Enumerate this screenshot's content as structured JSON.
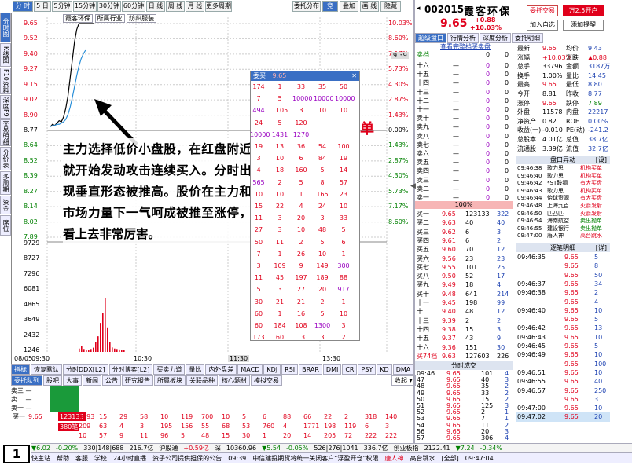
{
  "toolbar": {
    "tabs": [
      "分 时",
      "5 日",
      "5分钟",
      "15分钟",
      "30分钟",
      "60分钟",
      "日 线",
      "周 线",
      "月 线",
      "更多周期"
    ],
    "right_buttons": [
      "委托分布",
      "竞 价",
      "叠加",
      "画 线",
      "隐藏"
    ],
    "sector_tabs": [
      "霞客环保",
      "所属行业",
      "纺织服装"
    ]
  },
  "side_tabs": [
    "分时图",
    "K线图",
    "F10资料",
    "深度F9",
    "交易明细",
    "分价表",
    "多周期",
    "资金",
    "席位"
  ],
  "price_axis": {
    "left": [
      "9.65",
      "9.52",
      "9.40",
      "9.27",
      "9.15",
      "9.02",
      "8.90",
      "8.77",
      "8.64",
      "8.52",
      "8.39",
      "8.27",
      "8.14",
      "8.02",
      "7.89"
    ],
    "right": [
      "10.03%",
      "8.60%",
      "7.17%",
      "5.73%",
      "4.30%",
      "2.87%",
      "1.43%",
      "0.00%",
      "1.43%",
      "2.87%",
      "4.30%",
      "5.73%",
      "7.17%",
      "8.60%"
    ],
    "current_tag": "9.39"
  },
  "volume_axis": [
    "9729",
    "8727",
    "7296",
    "6081",
    "4865",
    "3649",
    "2432",
    "1216",
    "1246"
  ],
  "volume_axis_left": [
    "9729",
    "8727",
    "7296",
    "6081",
    "4865",
    "3649",
    "2432",
    "1246"
  ],
  "time_axis": [
    "09:30",
    "10:30",
    "11:30",
    "13:30"
  ],
  "date_label": "08/05",
  "annotation": {
    "text": "主力选择低价小盘股，在红盘附近就开始发动攻击连续买入。分时出现垂直形态被推高。股价在主力和市场力量下一气呵成被推至涨停，看上去非常厉害。",
    "badge": "机构封单",
    "page_number": "1"
  },
  "order_queue": {
    "header": "委买",
    "header_value": "9.65",
    "rows": [
      [
        "174",
        "1",
        "33",
        "35",
        "50"
      ],
      [
        "7",
        "5",
        "10000",
        "10000",
        "10000"
      ],
      [
        "494",
        "1105",
        "3",
        "10",
        "10"
      ],
      [
        "24",
        "5",
        "120",
        "",
        ""
      ],
      [
        "10000",
        "1431",
        "1270",
        "",
        ""
      ],
      [
        "19",
        "13",
        "36",
        "54",
        "100"
      ],
      [
        "3",
        "10",
        "6",
        "84",
        "19"
      ],
      [
        "4",
        "18",
        "160",
        "5",
        "14"
      ],
      [
        "565",
        "2",
        "5",
        "8",
        "57"
      ],
      [
        "10",
        "10",
        "1",
        "165",
        "23"
      ],
      [
        "15",
        "22",
        "4",
        "24",
        "10"
      ],
      [
        "11",
        "3",
        "20",
        "3",
        "33"
      ],
      [
        "27",
        "3",
        "10",
        "48",
        "5"
      ],
      [
        "50",
        "11",
        "2",
        "5",
        "6"
      ],
      [
        "7",
        "1",
        "26",
        "10",
        "1"
      ],
      [
        "3",
        "109",
        "9",
        "149",
        "300"
      ],
      [
        "11",
        "45",
        "197",
        "189",
        "88"
      ],
      [
        "5",
        "3",
        "27",
        "20",
        "917"
      ],
      [
        "30",
        "21",
        "21",
        "2",
        "1"
      ],
      [
        "60",
        "1",
        "16",
        "5",
        "10"
      ],
      [
        "60",
        "184",
        "108",
        "1300",
        "3"
      ],
      [
        "173",
        "60",
        "13",
        "3",
        "2"
      ]
    ]
  },
  "indicator_tabs": [
    "指标",
    "恢复默认",
    "分时DDX[L2]",
    "分时博弈[L2]",
    "买卖力道",
    "量比",
    "内外盘差",
    "MACD",
    "KDJ",
    "RSI",
    "BRAR",
    "DMI",
    "CR",
    "PSY",
    "KD",
    "DMA",
    "TRIX",
    "模板"
  ],
  "bottom_tabs": [
    "委托队列",
    "股吧",
    "大事",
    "新闻",
    "公告",
    "研究报告",
    "所属板块",
    "关联品种",
    "核心题材",
    "模拟交易"
  ],
  "bottom_dropdown": "收起",
  "bottom_queue": {
    "sell_labels": [
      "卖三 —",
      "卖二 —",
      "卖一 —"
    ],
    "buy_label": "买一",
    "buy_price": "9.65",
    "buy_total": "123133",
    "buy_count": "380笔",
    "rows": [
      [
        "2093",
        "15",
        "29",
        "58",
        "10",
        "119",
        "700",
        "10",
        "5",
        "6",
        "88",
        "66",
        "22",
        "2",
        "318",
        "140"
      ],
      [
        "209",
        "63",
        "4",
        "3",
        "195",
        "156",
        "55",
        "68",
        "53",
        "760",
        "4",
        "1771",
        "198",
        "119",
        "6",
        "3"
      ],
      [
        "10",
        "57",
        "9",
        "11",
        "96",
        "5",
        "48",
        "15",
        "30",
        "1",
        "20",
        "14",
        "205",
        "72",
        "222",
        "222"
      ]
    ]
  },
  "stock": {
    "code": "002015",
    "name": "霞客环保",
    "price": "9.65",
    "change": "+0.88",
    "change_pct": "+10.03%",
    "buttons": [
      "委托交易",
      "万2.5开户",
      "加入自选",
      "添加提醒"
    ]
  },
  "right_tabs": [
    "超级盘口",
    "行情分析",
    "深度分析",
    "委托明细"
  ],
  "quote_link": "查看完整档买卖盘",
  "sell_levels": {
    "header": [
      "卖档",
      "0",
      "0"
    ],
    "labels": [
      "十六",
      "十五",
      "十四",
      "十三",
      "十二",
      "十一",
      "卖十",
      "卖九",
      "卖八",
      "卖七",
      "卖六",
      "卖五",
      "卖四",
      "卖三",
      "卖二",
      "卖一"
    ]
  },
  "ratio_bar": "100%",
  "buy_levels": [
    [
      "买一",
      "9.65",
      "123133",
      "322"
    ],
    [
      "买二",
      "9.63",
      "40",
      "40"
    ],
    [
      "买三",
      "9.62",
      "6",
      "3"
    ],
    [
      "买四",
      "9.61",
      "6",
      "2"
    ],
    [
      "买五",
      "9.60",
      "70",
      "12"
    ],
    [
      "买六",
      "9.56",
      "23",
      "23"
    ],
    [
      "买七",
      "9.55",
      "101",
      "25"
    ],
    [
      "买八",
      "9.50",
      "52",
      "17"
    ],
    [
      "买九",
      "9.49",
      "18",
      "4"
    ],
    [
      "买十",
      "9.48",
      "641",
      "214"
    ],
    [
      "十一",
      "9.45",
      "198",
      "99"
    ],
    [
      "十二",
      "9.40",
      "48",
      "12"
    ],
    [
      "十三",
      "9.39",
      "2",
      "2"
    ],
    [
      "十四",
      "9.38",
      "15",
      "3"
    ],
    [
      "十五",
      "9.37",
      "43",
      "9"
    ],
    [
      "十六",
      "9.36",
      "151",
      "30"
    ]
  ],
  "buy_total": [
    "买74档",
    "9.63",
    "127603",
    "226"
  ],
  "fundamentals": [
    [
      "最新",
      "9.65",
      "均价",
      "9.43"
    ],
    [
      "涨幅",
      "+10.03%",
      "涨跌",
      "▲0.88"
    ],
    [
      "总手",
      "33796",
      "金额",
      "3187万"
    ],
    [
      "换手",
      "1.00%",
      "量比",
      "14.45"
    ],
    [
      "最高",
      "9.65",
      "最低",
      "8.80"
    ],
    [
      "今开",
      "8.81",
      "昨收",
      "8.77"
    ],
    [
      "涨停",
      "9.65",
      "跌停",
      "7.89"
    ],
    [
      "外盘",
      "11578",
      "内盘",
      "22217"
    ],
    [
      "净资产",
      "0.82",
      "ROE",
      "0.00%"
    ],
    [
      "收益(一)",
      "-0.010",
      "PE(动)",
      "-241.2"
    ],
    [
      "总股本",
      "4.01亿",
      "总值",
      "38.7亿"
    ],
    [
      "流通股",
      "3.39亿",
      "流值",
      "32.7亿"
    ]
  ],
  "movement_header": "盘口异动",
  "movement_settings": "[设]",
  "movements": [
    [
      "09:46:38",
      "歌力思",
      "机构买单"
    ],
    [
      "09:46:40",
      "歌力思",
      "机构买单"
    ],
    [
      "09:46:42",
      "*ST鞍钢",
      "有大买盘"
    ],
    [
      "09:46:43",
      "歌力思",
      "机构买单"
    ],
    [
      "09:46:44",
      "怡球资源",
      "有大买盘"
    ],
    [
      "09:46:48",
      "上海九百",
      "火箭发射"
    ],
    [
      "09:46:50",
      "匹凸匹",
      "火箭发射"
    ],
    [
      "09:46:54",
      "海南航空",
      "卖出抛单"
    ],
    [
      "09:46:55",
      "建设银行",
      "卖出抛单"
    ],
    [
      "09:47:00",
      "唐人神",
      "高台跳水"
    ]
  ],
  "detail_header": "逐笔明细",
  "detail_link": "[详]",
  "details": [
    [
      "09:46:35",
      "9.65",
      "5"
    ],
    [
      "",
      "9.65",
      "8"
    ],
    [
      "",
      "9.65",
      "50"
    ],
    [
      "09:46:37",
      "9.65",
      "34"
    ],
    [
      "09:46:38",
      "9.65",
      "2"
    ],
    [
      "",
      "9.65",
      "4"
    ],
    [
      "09:46:40",
      "9.65",
      "10"
    ],
    [
      "",
      "9.65",
      "5"
    ],
    [
      "09:46:42",
      "9.65",
      "13"
    ],
    [
      "09:46:43",
      "9.65",
      "10"
    ],
    [
      "09:46:45",
      "9.65",
      "5"
    ],
    [
      "09:46:49",
      "9.65",
      "10"
    ],
    [
      "",
      "9.65",
      "100"
    ],
    [
      "09:46:51",
      "9.65",
      "10"
    ],
    [
      "09:46:55",
      "9.65",
      "40"
    ],
    [
      "09:46:57",
      "9.65",
      "250"
    ],
    [
      "",
      "9.65",
      "3"
    ],
    [
      "09:47:00",
      "9.65",
      "10"
    ],
    [
      "09:47:02",
      "9.65",
      "20"
    ]
  ],
  "trade_header": "分时成交",
  "trades": [
    [
      "09:46",
      "9.65",
      "101",
      "4"
    ],
    [
      "47",
      "9.65",
      "40",
      "3"
    ],
    [
      "48",
      "9.65",
      "35",
      "2"
    ],
    [
      "49",
      "9.65",
      "33",
      "2"
    ],
    [
      "50",
      "9.65",
      "15",
      "2"
    ],
    [
      "51",
      "9.65",
      "125",
      "3"
    ],
    [
      "52",
      "9.65",
      "2",
      "1"
    ],
    [
      "53",
      "9.65",
      "7",
      "1"
    ],
    [
      "54",
      "9.65",
      "11",
      "2"
    ],
    [
      "56",
      "9.65",
      "20",
      "3"
    ],
    [
      "57",
      "9.65",
      "306",
      "4"
    ]
  ],
  "status_bar": {
    "items": [
      "▼6.02",
      "-0.20%",
      "330|148|688",
      "216.7亿",
      "沪股通",
      "+0.59亿",
      "深",
      "10360.96",
      "▼5.54",
      "-0.05%",
      "526|276|1041",
      "336.7亿"
    ],
    "extra": [
      "创业板指",
      "2122.41",
      "▼7.24",
      "-0.34%"
    ]
  },
  "ticker_bar": {
    "items": [
      "快主站",
      "帮助",
      "客服",
      "学校",
      "24小时直播",
      "资子公司提供担保的公告",
      "09:39",
      "中信建投期货将统一关闭客户“浮盈开仓”权限",
      "唐人神",
      "高台跳水",
      "[全部]",
      "09:47:04"
    ]
  },
  "colors": {
    "up": "#e0001b",
    "down": "#008000",
    "accent": "#3a6fc4",
    "price_line": "#000000",
    "avg_line": "#2a8fd8"
  }
}
